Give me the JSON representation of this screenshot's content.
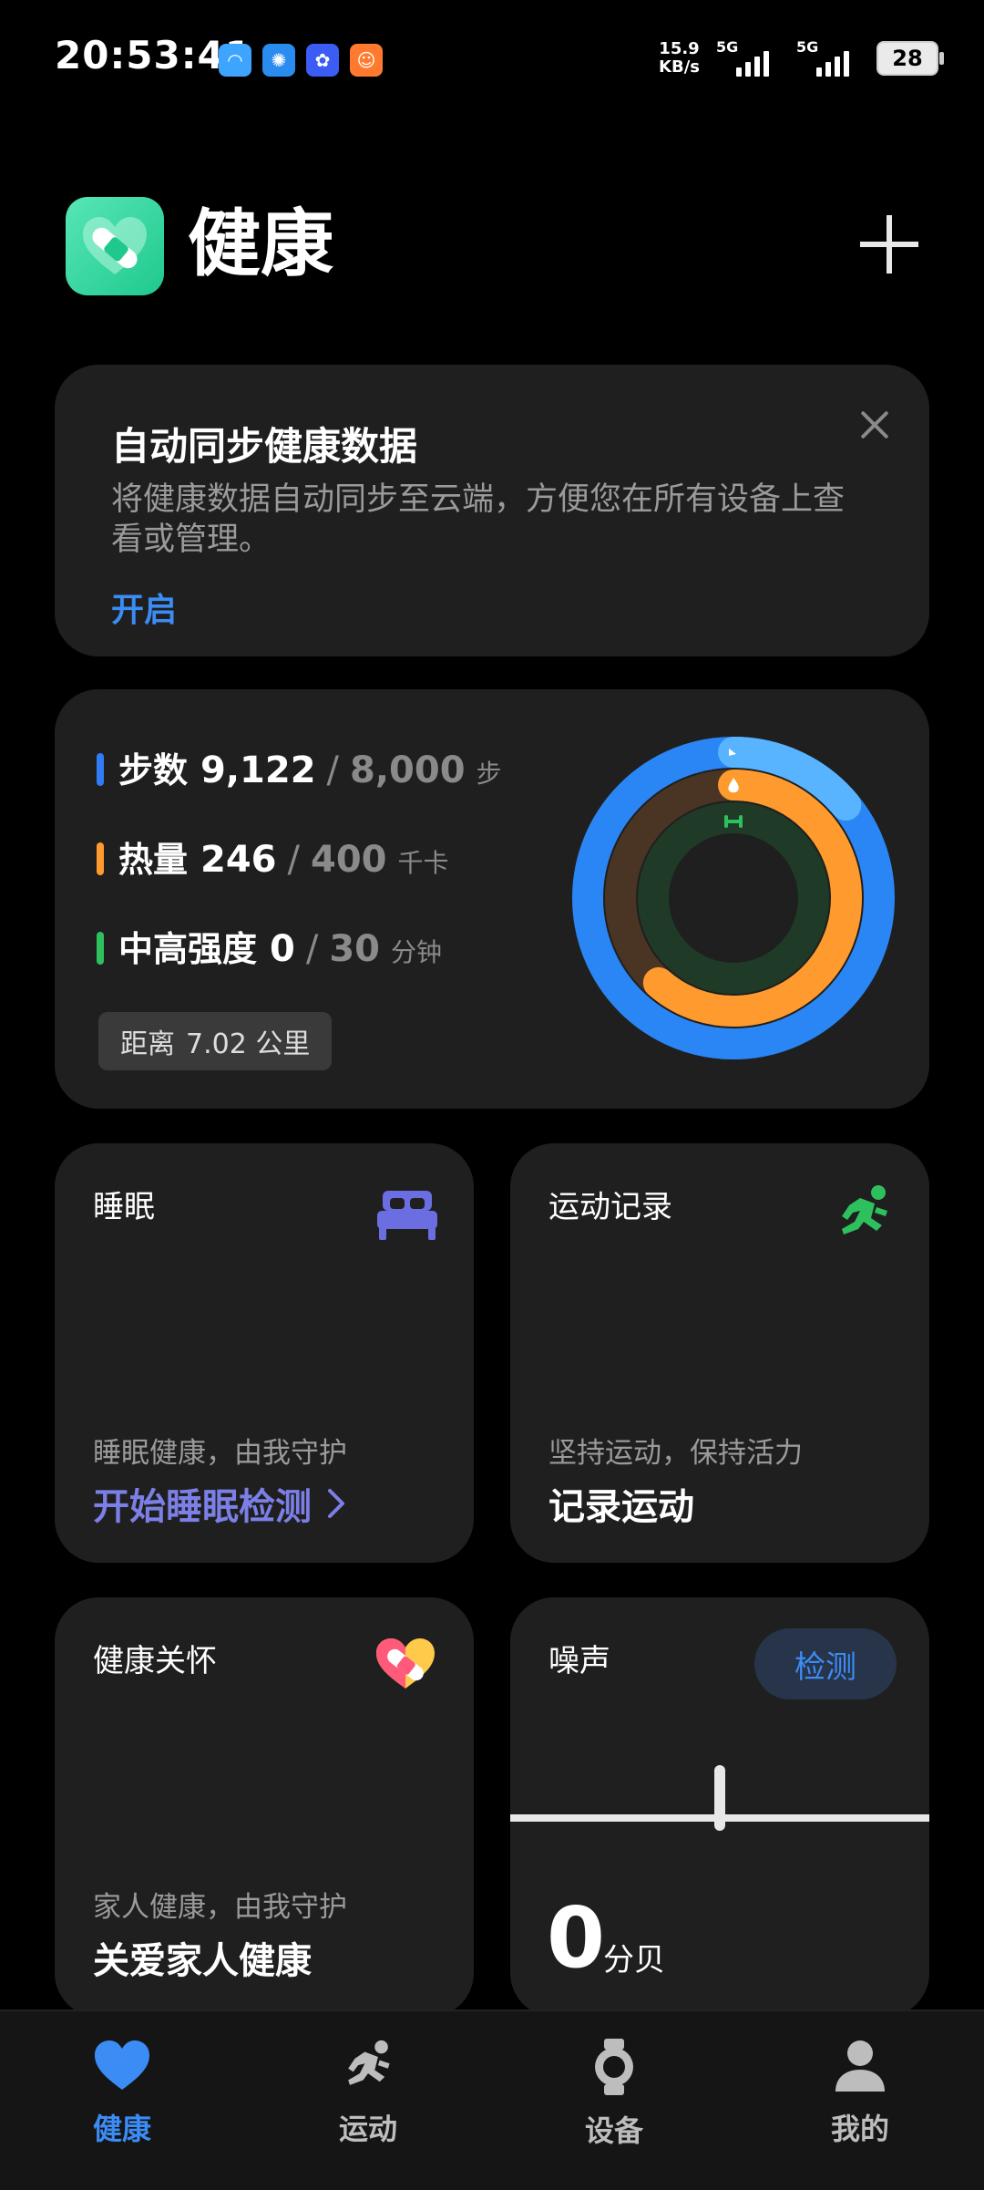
{
  "status_bar": {
    "time": "20:53:41",
    "net_speed_value": "15.9",
    "net_speed_unit": "KB/s",
    "signal1_type": "5G",
    "signal2_type": "5G",
    "battery": "28"
  },
  "header": {
    "title": "健康"
  },
  "sync_card": {
    "title": "自动同步健康数据",
    "description": "将健康数据自动同步至云端，方便您在所有设备上查看或管理。",
    "action": "开启"
  },
  "activity": {
    "steps": {
      "label": "步数",
      "current": "9,122",
      "sep": "/",
      "goal": "8,000",
      "unit": "步",
      "color": "#2f7cf6",
      "progress": 1.14
    },
    "calories": {
      "label": "热量",
      "current": "246",
      "sep": "/",
      "goal": "400",
      "unit": "千卡",
      "color": "#ff9a2e",
      "progress": 0.615
    },
    "intensity": {
      "label": "中高强度",
      "current": "0",
      "sep": "/",
      "goal": "30",
      "unit": "分钟",
      "color": "#2ec05c",
      "progress": 0
    },
    "distance_label": "距离",
    "distance_value": "7.02 公里"
  },
  "tiles": {
    "sleep": {
      "title": "睡眠",
      "subtitle": "睡眠健康，由我守护",
      "action": "开始睡眠检测",
      "action_color": "#7b7fe6"
    },
    "exercise": {
      "title": "运动记录",
      "subtitle": "坚持运动，保持活力",
      "action": "记录运动"
    },
    "care": {
      "title": "健康关怀",
      "subtitle": "家人健康，由我守护",
      "action": "关爱家人健康"
    },
    "noise": {
      "title": "噪声",
      "button": "检测",
      "value": "0",
      "unit": "分贝"
    }
  },
  "bottom_nav": [
    {
      "label": "健康",
      "active": true
    },
    {
      "label": "运动",
      "active": false
    },
    {
      "label": "设备",
      "active": false
    },
    {
      "label": "我的",
      "active": false
    }
  ],
  "colors": {
    "accent_blue": "#3b8cf5",
    "card_bg": "#1f1f1f",
    "brand_green": "#1fc98e"
  }
}
